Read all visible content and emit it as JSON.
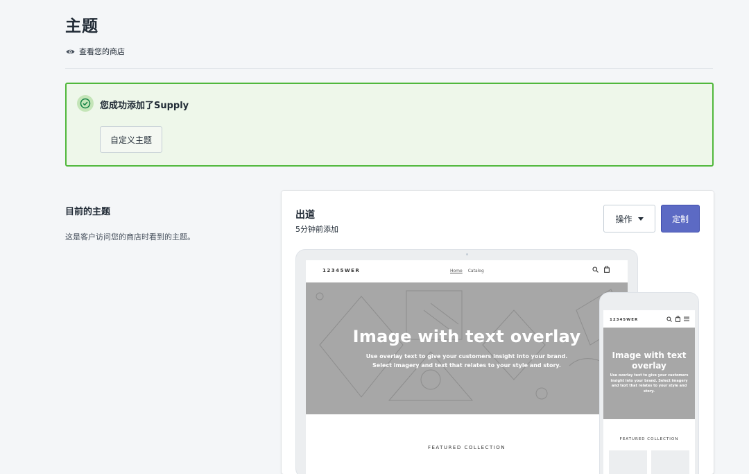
{
  "page": {
    "title": "主题",
    "view_store_label": "查看您的商店"
  },
  "banner": {
    "message": "您成功添加了Supply",
    "customize_label": "自定义主题",
    "accent_color": "#50b83c"
  },
  "current_theme_section": {
    "title": "目前的主题",
    "description": "这是客户访问您的商店时看到的主题。"
  },
  "theme_card": {
    "name": "出道",
    "added": "5分钟前添加",
    "actions_label": "操作",
    "customize_label": "定制",
    "primary_color": "#5c6ac4"
  },
  "preview": {
    "store_name": "12345WER",
    "nav": [
      "Home",
      "Catalog"
    ],
    "hero_title": "Image with text overlay",
    "hero_subtitle_1": "Use overlay text to give your customers insight into your brand.",
    "hero_subtitle_2": "Select imagery and text that relates to your style and story.",
    "featured_label": "FEATURED COLLECTION",
    "mobile_hero_title": "Image with text overlay",
    "mobile_hero_subtitle": "Use overlay text to give your customers insight into your brand. Select imagery and text that relates to your style and story."
  },
  "icons": {
    "view_store": "eye-icon",
    "success": "check-circle-icon",
    "dropdown": "caret-down-icon",
    "search": "search-icon",
    "cart": "bag-icon",
    "menu": "hamburger-icon"
  }
}
